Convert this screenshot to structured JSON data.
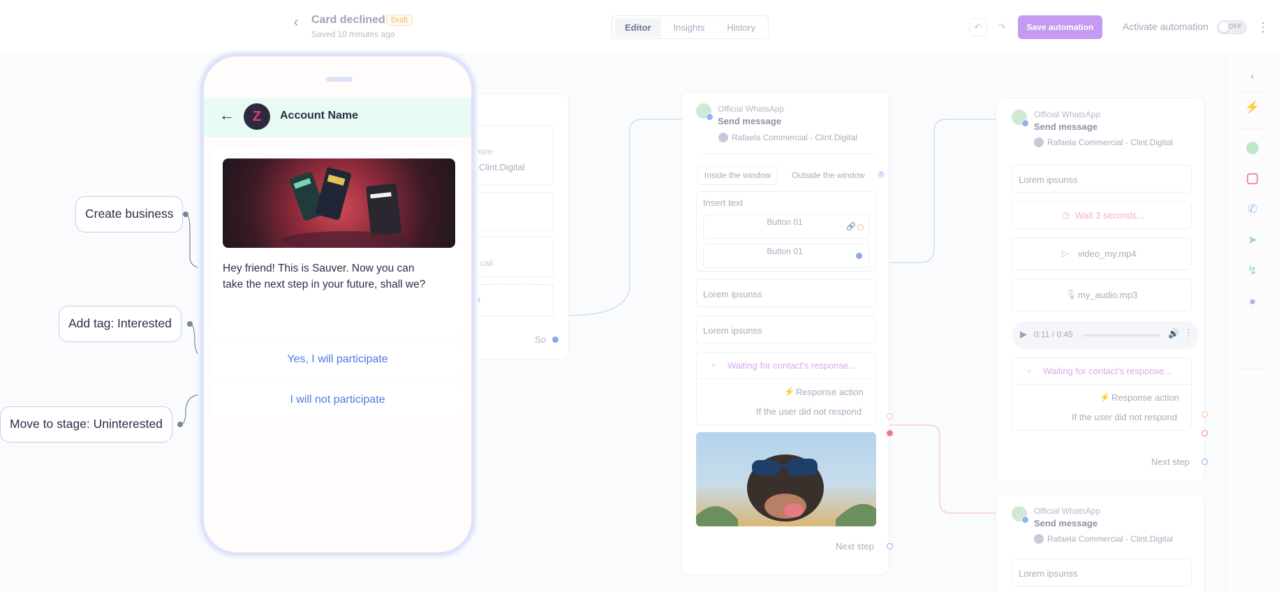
{
  "header": {
    "title": "Card declined",
    "draft_badge": "Draft",
    "saved_text": "Saved 10 minutes ago",
    "tabs": [
      {
        "label": "Editor",
        "active": true
      },
      {
        "label": "Insights",
        "active": false
      },
      {
        "label": "History",
        "active": false
      }
    ],
    "save_label": "Save automation",
    "activate_label": "Activate automation",
    "toggle_label": "OFF",
    "toggle_on": false
  },
  "rail": {
    "icons": [
      "chevron-left-icon",
      "lightning-icon",
      "whatsapp-icon",
      "instagram-icon",
      "phone-call-icon",
      "send-icon",
      "lightning-icon",
      "microphone-icon"
    ]
  },
  "left_card": {
    "text_more": "more",
    "account_suffix": "- Clint.Digital",
    "call_text": "h call",
    "dashed_text": "er",
    "footer_label": "So"
  },
  "mid_card": {
    "kind": "Official WhatsApp",
    "title": "Send message",
    "account": "Rafaela Commercial - Clint.Digital",
    "window_tabs": [
      "Inside the window",
      "Outside the window"
    ],
    "insert_text": "Insert text",
    "buttons": [
      "Button 01",
      "Button 01"
    ],
    "lorem_1": "Lorem ipsunss",
    "lorem_2": "Lorem ipsunss",
    "waiting": "Waiting for contact's response...",
    "response_action": "Response action",
    "no_respond": "If the user did not respond",
    "next_step": "Next step"
  },
  "right_card_top": {
    "kind": "Official WhatsApp",
    "title": "Send message",
    "account": "Rafaela Commercial - Clint.Digital",
    "lorem": "Lorem ipsunss",
    "wait": "Wait 3 seconds...",
    "video": "video_my.mp4",
    "audio": "my_audio.mp3",
    "player_time": "0:11 / 0:45",
    "waiting": "Waiting for contact's response...",
    "response_action": "Response action",
    "no_respond": "If the user did not respond",
    "next_step": "Next step"
  },
  "right_card_bottom": {
    "kind": "Official WhatsApp",
    "title": "Send message",
    "account": "Rafaela Commercial - Clint.Digital",
    "lorem": "Lorem ipsunss"
  },
  "phone": {
    "account_name": "Account Name",
    "message": "Hey friend! This is Sauver. Now you can take the next step in your future, shall we?",
    "replies": [
      "Yes, I will participate",
      "I will not participate"
    ]
  },
  "annotations": {
    "create_business": "Create business",
    "add_tag": "Add tag: Interested",
    "move_stage": "Move to stage: Uninterested"
  },
  "colors": {
    "accent": "#c59af0",
    "link_blue": "#4e79e6",
    "phone_header": "#e9fbf5",
    "dot_red": "#f07a84",
    "dot_blue": "#8fa7ee",
    "dot_orange": "#f7c08f"
  }
}
